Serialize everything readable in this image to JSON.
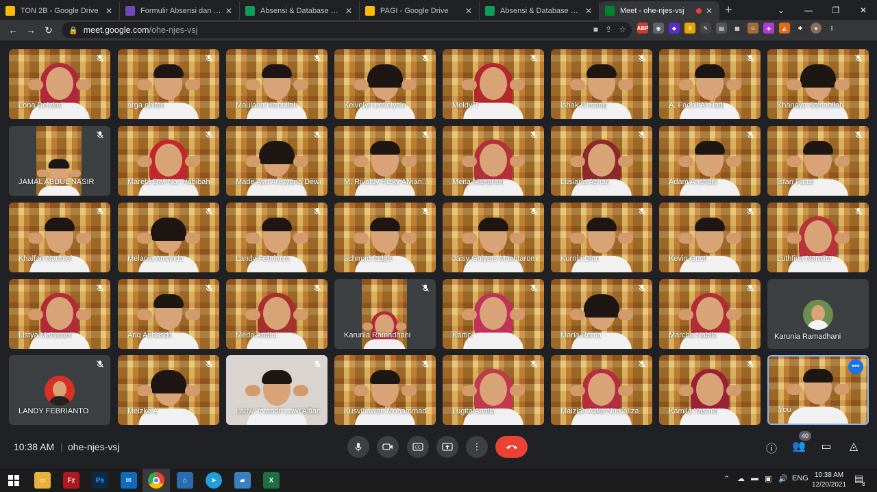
{
  "browser": {
    "tabs": [
      {
        "title": "TON 2B - Google Drive",
        "icon": "google-drive-icon",
        "color": "#fbbc04"
      },
      {
        "title": "Formulir Absensi dan Evidence",
        "icon": "google-forms-icon",
        "color": "#7248b9"
      },
      {
        "title": "Absensi & Database 2B - Google",
        "icon": "google-sheets-icon",
        "color": "#0f9d58"
      },
      {
        "title": "PAGI - Google Drive",
        "icon": "google-drive-icon",
        "color": "#fbbc04"
      },
      {
        "title": "Absensi & Database 2B - Google",
        "icon": "google-sheets-icon",
        "color": "#0f9d58"
      },
      {
        "title": "Meet - ohe-njes-vsj",
        "icon": "google-meet-icon",
        "color": "#00832d"
      }
    ],
    "new_tab": "+",
    "url_host": "meet.google.com",
    "url_path": "/ohe-njes-vsj"
  },
  "participants": [
    {
      "name": "Lona Delviari",
      "type": "video",
      "look": "hijab",
      "hijab": "#b0283b"
    },
    {
      "name": "arga ghifari",
      "type": "video",
      "look": "boy"
    },
    {
      "name": "Maulana Hizbullah",
      "type": "video",
      "look": "boy"
    },
    {
      "name": "Keivelyn Lovelycia",
      "type": "video",
      "look": "girl"
    },
    {
      "name": "Meldy T",
      "type": "video",
      "look": "hijab",
      "hijab": "#b3262c"
    },
    {
      "name": "Ishak Girsang",
      "type": "video",
      "look": "boy"
    },
    {
      "name": "A. Fadhil Al Hadi",
      "type": "video",
      "look": "boy"
    },
    {
      "name": "Khanaya Salsabilah",
      "type": "video",
      "look": "girl"
    },
    {
      "name": "JAMAL ABDUL NASIR",
      "type": "inset",
      "look": "boy"
    },
    {
      "name": "Mareta Dwi Nor Habibah",
      "type": "video",
      "look": "hijab",
      "hijab": "#c1272d"
    },
    {
      "name": "Made Ayu Aristyana Dewi",
      "type": "video",
      "look": "girl"
    },
    {
      "name": "M. Rivaldy Rizky Alviansyah",
      "type": "video",
      "look": "boy"
    },
    {
      "name": "Meita Maharani",
      "type": "video",
      "look": "hijab",
      "hijab": "#b52f3b"
    },
    {
      "name": "Lusiana Azhari",
      "type": "video",
      "look": "hijab",
      "hijab": "#8c2a2a"
    },
    {
      "name": "Adam Anshary",
      "type": "video",
      "look": "boy"
    },
    {
      "name": "Isfan Fauzi",
      "type": "video",
      "look": "boy"
    },
    {
      "name": "Khalfan Nadhief",
      "type": "video",
      "look": "boy"
    },
    {
      "name": "Melania Amanda",
      "type": "video",
      "look": "girl"
    },
    {
      "name": "Landy Febrianto",
      "type": "video",
      "look": "boy"
    },
    {
      "name": "achmad fadjrie",
      "type": "video",
      "look": "boy"
    },
    {
      "name": "Jaisy Ghiyats Muchtarom",
      "type": "video",
      "look": "boy"
    },
    {
      "name": "Kurnia Dian",
      "type": "video",
      "look": "boy"
    },
    {
      "name": "Kevin Gusti",
      "type": "video",
      "look": "boy"
    },
    {
      "name": "Luthfina Narulita",
      "type": "video",
      "look": "hijab",
      "hijab": "#b8323a"
    },
    {
      "name": "Listya Maharani",
      "type": "video",
      "look": "hijab",
      "hijab": "#b32b38"
    },
    {
      "name": "Ariq Anhasdit",
      "type": "video",
      "look": "boy"
    },
    {
      "name": "Meda Andini",
      "type": "video",
      "look": "hijab",
      "hijab": "#a5302e"
    },
    {
      "name": "Karunia Ramadhani",
      "type": "inset",
      "look": "hijab",
      "hijab": "#b5283a"
    },
    {
      "name": "Kartini",
      "type": "video",
      "look": "hijab",
      "hijab": "#c2315a"
    },
    {
      "name": "Maria Renta",
      "type": "video",
      "look": "girl"
    },
    {
      "name": "Marcha Nabila",
      "type": "video",
      "look": "hijab",
      "hijab": "#b22b36"
    },
    {
      "name": "Karunia Ramadhani",
      "type": "avatar",
      "avatar_color": "#6b8f4e"
    },
    {
      "name": "LANDY FEBRIANTO",
      "type": "avatar-red",
      "avatar_color": "#d93025"
    },
    {
      "name": "Meizke A",
      "type": "video",
      "look": "girl"
    },
    {
      "name": "Lauw, Irvandri Lawi Alfian",
      "type": "video",
      "look": "boy",
      "bg": "plain"
    },
    {
      "name": "Kusvihawan Muhammad",
      "type": "video",
      "look": "boy"
    },
    {
      "name": "Lugita Analia",
      "type": "video",
      "look": "hijab",
      "hijab": "#c0394d"
    },
    {
      "name": "Maiziah Azka Nurhaliza",
      "type": "video",
      "look": "hijab",
      "hijab": "#b62d40"
    },
    {
      "name": "Kamila Yasmin",
      "type": "video",
      "look": "hijab",
      "hijab": "#9c2136"
    },
    {
      "name": "You",
      "type": "self",
      "look": "boy"
    }
  ],
  "meeting": {
    "time": "10:38 AM",
    "separator": "|",
    "code": "ohe-njes-vsj",
    "people_count": "40",
    "controls": [
      "microphone-icon",
      "camera-icon",
      "captions-icon",
      "present-icon",
      "more-options-icon",
      "hangup-icon"
    ],
    "right_controls": [
      "info-icon",
      "people-icon",
      "chat-icon",
      "activities-icon"
    ]
  },
  "taskbar": {
    "tray_lang": "ENG",
    "clock_time": "10:38 AM",
    "clock_date": "12/20/2021",
    "notification_count": "8"
  },
  "colors": {
    "meet_bg": "#202124",
    "hangup": "#ea4335",
    "self_border": "#8ab4f8"
  }
}
